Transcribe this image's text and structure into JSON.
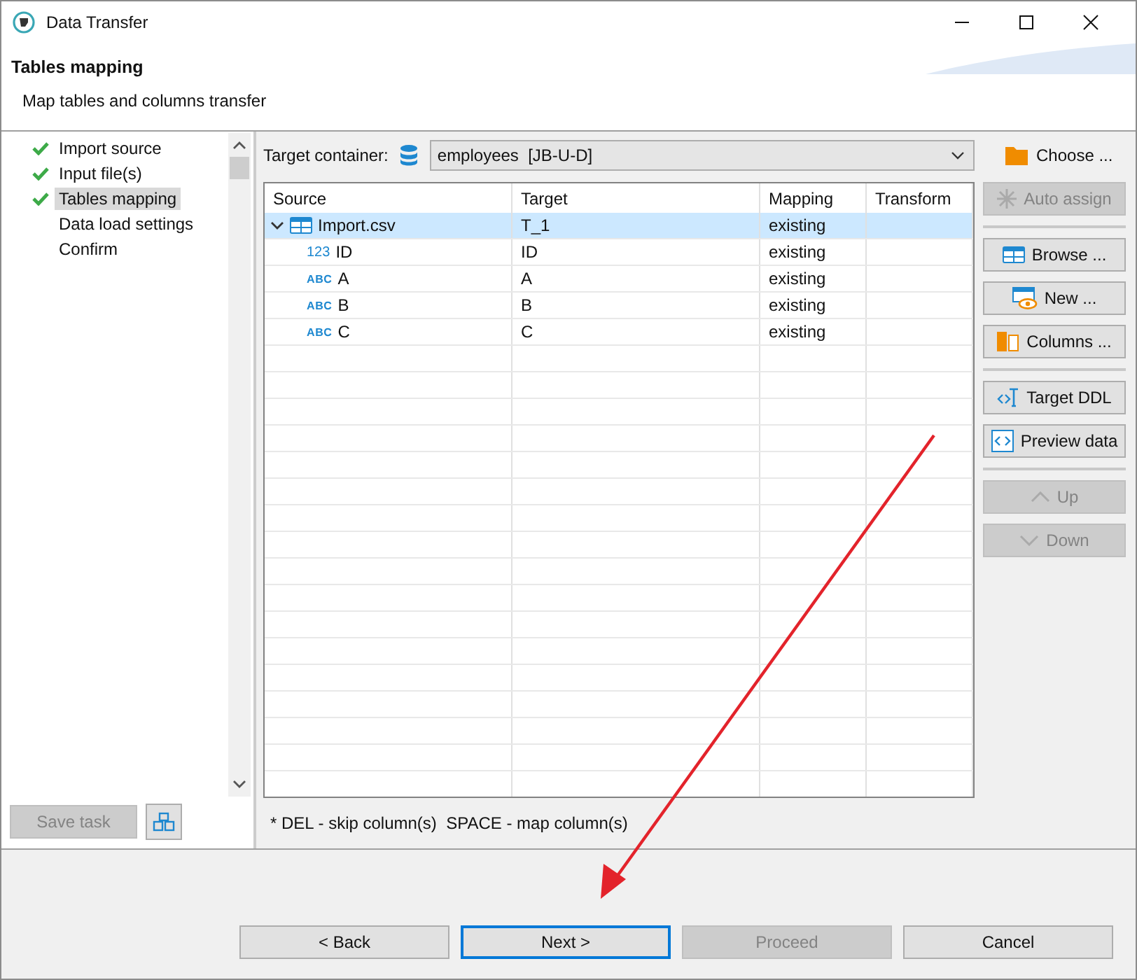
{
  "window": {
    "title": "Data Transfer"
  },
  "header": {
    "title": "Tables mapping",
    "subtitle": "Map tables and columns transfer"
  },
  "steps": [
    {
      "label": "Import source",
      "done": true,
      "selected": false
    },
    {
      "label": "Input file(s)",
      "done": true,
      "selected": false
    },
    {
      "label": "Tables mapping",
      "done": true,
      "selected": true
    },
    {
      "label": "Data load settings",
      "done": false,
      "selected": false
    },
    {
      "label": "Confirm",
      "done": false,
      "selected": false
    }
  ],
  "save_task": {
    "label": "Save task",
    "disabled": true
  },
  "target_container": {
    "label": "Target container:",
    "value": "employees  [JB-U-D]",
    "choose_label": "Choose ..."
  },
  "table": {
    "columns": [
      "Source",
      "Target",
      "Mapping",
      "Transform"
    ],
    "rows": [
      {
        "kind": "table",
        "source": "Import.csv",
        "target": "T_1",
        "mapping": "existing",
        "expanded": true,
        "selected": true,
        "children": [
          {
            "kind": "number",
            "type_badge": "123",
            "source": "ID",
            "target": "ID",
            "mapping": "existing",
            "selected": false
          },
          {
            "kind": "string",
            "type_badge": "ABC",
            "source": "A",
            "target": "A",
            "mapping": "existing",
            "selected": false
          },
          {
            "kind": "string",
            "type_badge": "ABC",
            "source": "B",
            "target": "B",
            "mapping": "existing",
            "selected": false
          },
          {
            "kind": "string",
            "type_badge": "ABC",
            "source": "C",
            "target": "C",
            "mapping": "existing",
            "selected": false
          }
        ]
      }
    ]
  },
  "side_buttons": [
    [
      {
        "label": "Auto assign",
        "kind": "asterisk",
        "disabled": true
      }
    ],
    [
      {
        "label": "Browse ...",
        "kind": "table",
        "disabled": false
      },
      {
        "label": "New ...",
        "kind": "new-table",
        "disabled": false
      },
      {
        "label": "Columns ...",
        "kind": "columns",
        "disabled": false
      }
    ],
    [
      {
        "label": "Target DDL",
        "kind": "ddl",
        "disabled": false
      },
      {
        "label": "Preview data",
        "kind": "preview",
        "disabled": false
      }
    ],
    [
      {
        "label": "Up",
        "kind": "up",
        "disabled": true
      },
      {
        "label": "Down",
        "kind": "down",
        "disabled": true
      }
    ]
  ],
  "hint": "* DEL - skip column(s)  SPACE - map column(s)",
  "footer_buttons": [
    {
      "label": "< Back",
      "disabled": false,
      "default": false
    },
    {
      "label": "Next >",
      "disabled": false,
      "default": true
    },
    {
      "label": "Proceed",
      "disabled": true,
      "default": false
    },
    {
      "label": "Cancel",
      "disabled": false,
      "default": false
    }
  ]
}
